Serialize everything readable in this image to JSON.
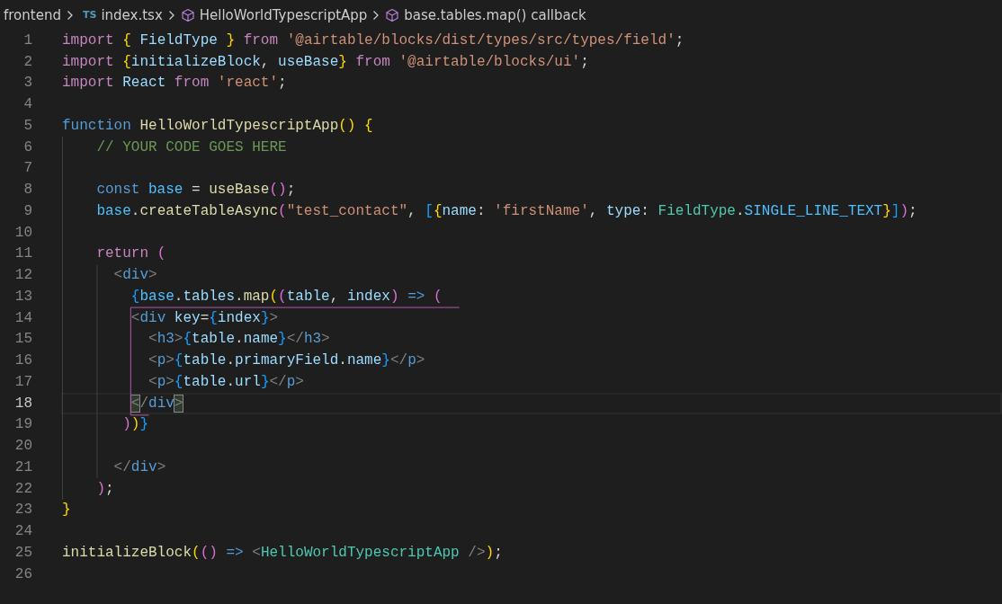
{
  "breadcrumb": [
    {
      "kind": "folder",
      "label": "frontend"
    },
    {
      "kind": "file",
      "badge": "TS",
      "label": "index.tsx"
    },
    {
      "kind": "symbol",
      "label": "HelloWorldTypescriptApp"
    },
    {
      "kind": "symbol",
      "label": "base.tables.map() callback"
    }
  ],
  "editor": {
    "lines": [
      {
        "number": "1",
        "current": false,
        "tokens": [
          {
            "kind": "keyword",
            "text": "import "
          },
          {
            "kind": "bracket1",
            "text": "{"
          },
          {
            "kind": "variable",
            "text": " FieldType "
          },
          {
            "kind": "bracket1",
            "text": "} "
          },
          {
            "kind": "keyword",
            "text": "from "
          },
          {
            "kind": "string",
            "text": "'@airtable/blocks/dist/types/src/types/field'"
          },
          {
            "kind": "plain",
            "text": ";"
          }
        ]
      },
      {
        "number": "2",
        "current": false,
        "tokens": [
          {
            "kind": "keyword",
            "text": "import "
          },
          {
            "kind": "bracket1",
            "text": "{"
          },
          {
            "kind": "variable",
            "text": "initializeBlock"
          },
          {
            "kind": "plain",
            "text": ", "
          },
          {
            "kind": "variable",
            "text": "useBase"
          },
          {
            "kind": "bracket1",
            "text": "} "
          },
          {
            "kind": "keyword",
            "text": "from "
          },
          {
            "kind": "string",
            "text": "'@airtable/blocks/ui'"
          },
          {
            "kind": "plain",
            "text": ";"
          }
        ]
      },
      {
        "number": "3",
        "current": false,
        "tokens": [
          {
            "kind": "keyword",
            "text": "import "
          },
          {
            "kind": "variable",
            "text": "React "
          },
          {
            "kind": "keyword",
            "text": "from "
          },
          {
            "kind": "string",
            "text": "'react'"
          },
          {
            "kind": "plain",
            "text": ";"
          }
        ]
      },
      {
        "number": "4",
        "current": false
      },
      {
        "number": "5",
        "current": false,
        "tokens": [
          {
            "kind": "storage",
            "text": "function "
          },
          {
            "kind": "function",
            "text": "HelloWorldTypescriptApp"
          },
          {
            "kind": "bracket1",
            "text": "() "
          },
          {
            "kind": "bracket1",
            "text": "{"
          }
        ]
      },
      {
        "number": "6",
        "current": false,
        "tokens": [
          {
            "kind": "comment",
            "text": "    // YOUR CODE GOES HERE"
          }
        ]
      },
      {
        "number": "7",
        "current": false
      },
      {
        "number": "8",
        "current": false,
        "tokens": [
          {
            "kind": "storage",
            "text": "    const "
          },
          {
            "kind": "constant",
            "text": "base"
          },
          {
            "kind": "plain",
            "text": " = "
          },
          {
            "kind": "function",
            "text": "useBase"
          },
          {
            "kind": "bracket2",
            "text": "()"
          },
          {
            "kind": "plain",
            "text": ";"
          }
        ]
      },
      {
        "number": "9",
        "current": false,
        "tokens": [
          {
            "kind": "constant",
            "text": "    base"
          },
          {
            "kind": "plain",
            "text": "."
          },
          {
            "kind": "function",
            "text": "createTableAsync"
          },
          {
            "kind": "bracket2",
            "text": "("
          },
          {
            "kind": "string",
            "text": "\"test_contact\""
          },
          {
            "kind": "plain",
            "text": ", "
          },
          {
            "kind": "bracket3",
            "text": "["
          },
          {
            "kind": "bracket1",
            "text": "{"
          },
          {
            "kind": "variable",
            "text": "name"
          },
          {
            "kind": "plain",
            "text": ": "
          },
          {
            "kind": "string",
            "text": "'firstName'"
          },
          {
            "kind": "plain",
            "text": ", "
          },
          {
            "kind": "variable",
            "text": "type"
          },
          {
            "kind": "plain",
            "text": ": "
          },
          {
            "kind": "type",
            "text": "FieldType"
          },
          {
            "kind": "plain",
            "text": "."
          },
          {
            "kind": "constant",
            "text": "SINGLE_LINE_TEXT"
          },
          {
            "kind": "bracket1",
            "text": "}"
          },
          {
            "kind": "bracket3",
            "text": "]"
          },
          {
            "kind": "bracket2",
            "text": ")"
          },
          {
            "kind": "plain",
            "text": ";"
          }
        ]
      },
      {
        "number": "10",
        "current": false
      },
      {
        "number": "11",
        "current": false,
        "tokens": [
          {
            "kind": "keyword",
            "text": "    return "
          },
          {
            "kind": "bracket2",
            "text": "("
          }
        ]
      },
      {
        "number": "12",
        "current": false,
        "tokens": [
          {
            "kind": "angle",
            "text": "      <"
          },
          {
            "kind": "tag",
            "text": "div"
          },
          {
            "kind": "angle",
            "text": ">"
          }
        ]
      },
      {
        "number": "13",
        "current": false,
        "tokens": [
          {
            "kind": "bracket3",
            "text": "        {"
          },
          {
            "kind": "constant",
            "text": "base"
          },
          {
            "kind": "plain",
            "text": "."
          },
          {
            "kind": "variable",
            "text": "tables"
          },
          {
            "kind": "plain",
            "text": "."
          },
          {
            "kind": "function",
            "text": "map"
          },
          {
            "kind": "bracket1",
            "text": "("
          },
          {
            "kind": "bracket2",
            "text": "("
          },
          {
            "kind": "variable",
            "text": "table"
          },
          {
            "kind": "plain",
            "text": ", "
          },
          {
            "kind": "variable",
            "text": "index"
          },
          {
            "kind": "bracket2",
            "text": ") "
          },
          {
            "kind": "storage",
            "text": "=> "
          },
          {
            "kind": "bracket2",
            "text": "("
          }
        ]
      },
      {
        "number": "14",
        "current": false,
        "tokens": [
          {
            "kind": "angle",
            "text": "        <"
          },
          {
            "kind": "tag",
            "text": "div "
          },
          {
            "kind": "variable",
            "text": "key"
          },
          {
            "kind": "plain",
            "text": "="
          },
          {
            "kind": "bracket3",
            "text": "{"
          },
          {
            "kind": "variable",
            "text": "index"
          },
          {
            "kind": "bracket3",
            "text": "}"
          },
          {
            "kind": "angle",
            "text": ">"
          }
        ]
      },
      {
        "number": "15",
        "current": false,
        "tokens": [
          {
            "kind": "angle",
            "text": "          <"
          },
          {
            "kind": "tag",
            "text": "h3"
          },
          {
            "kind": "angle",
            "text": ">"
          },
          {
            "kind": "bracket3",
            "text": "{"
          },
          {
            "kind": "variable",
            "text": "table"
          },
          {
            "kind": "plain",
            "text": "."
          },
          {
            "kind": "variable",
            "text": "name"
          },
          {
            "kind": "bracket3",
            "text": "}"
          },
          {
            "kind": "angle",
            "text": "</"
          },
          {
            "kind": "tag",
            "text": "h3"
          },
          {
            "kind": "angle",
            "text": ">"
          }
        ]
      },
      {
        "number": "16",
        "current": false,
        "tokens": [
          {
            "kind": "angle",
            "text": "          <"
          },
          {
            "kind": "tag",
            "text": "p"
          },
          {
            "kind": "angle",
            "text": ">"
          },
          {
            "kind": "bracket3",
            "text": "{"
          },
          {
            "kind": "variable",
            "text": "table"
          },
          {
            "kind": "plain",
            "text": "."
          },
          {
            "kind": "variable",
            "text": "primaryField"
          },
          {
            "kind": "plain",
            "text": "."
          },
          {
            "kind": "variable",
            "text": "name"
          },
          {
            "kind": "bracket3",
            "text": "}"
          },
          {
            "kind": "angle",
            "text": "</"
          },
          {
            "kind": "tag",
            "text": "p"
          },
          {
            "kind": "angle",
            "text": ">"
          }
        ]
      },
      {
        "number": "17",
        "current": false,
        "tokens": [
          {
            "kind": "angle",
            "text": "          <"
          },
          {
            "kind": "tag",
            "text": "p"
          },
          {
            "kind": "angle",
            "text": ">"
          },
          {
            "kind": "bracket3",
            "text": "{"
          },
          {
            "kind": "variable",
            "text": "table"
          },
          {
            "kind": "plain",
            "text": "."
          },
          {
            "kind": "variable",
            "text": "url"
          },
          {
            "kind": "bracket3",
            "text": "}"
          },
          {
            "kind": "angle",
            "text": "</"
          },
          {
            "kind": "tag",
            "text": "p"
          },
          {
            "kind": "angle",
            "text": ">"
          }
        ]
      },
      {
        "number": "18",
        "current": true,
        "tokens": [
          {
            "kind": "angle-match",
            "text": "        <"
          },
          {
            "kind": "angle",
            "text": "/"
          },
          {
            "kind": "tag",
            "text": "div"
          },
          {
            "kind": "angle-match",
            "text": ">"
          }
        ]
      },
      {
        "number": "19",
        "current": false,
        "tokens": [
          {
            "kind": "bracket2",
            "text": "       )"
          },
          {
            "kind": "bracket1",
            "text": ")"
          },
          {
            "kind": "bracket3",
            "text": "}"
          }
        ]
      },
      {
        "number": "20",
        "current": false
      },
      {
        "number": "21",
        "current": false,
        "tokens": [
          {
            "kind": "angle",
            "text": "      </"
          },
          {
            "kind": "tag",
            "text": "div"
          },
          {
            "kind": "angle",
            "text": ">"
          }
        ]
      },
      {
        "number": "22",
        "current": false,
        "tokens": [
          {
            "kind": "bracket2",
            "text": "    )"
          },
          {
            "kind": "plain",
            "text": ";"
          }
        ]
      },
      {
        "number": "23",
        "current": false,
        "tokens": [
          {
            "kind": "bracket1",
            "text": "}"
          }
        ]
      },
      {
        "number": "24",
        "current": false
      },
      {
        "number": "25",
        "current": false,
        "tokens": [
          {
            "kind": "function",
            "text": "initializeBlock"
          },
          {
            "kind": "bracket1",
            "text": "("
          },
          {
            "kind": "bracket2",
            "text": "() "
          },
          {
            "kind": "storage",
            "text": "=> "
          },
          {
            "kind": "angle",
            "text": "<"
          },
          {
            "kind": "type",
            "text": "HelloWorldTypescriptApp "
          },
          {
            "kind": "angle",
            "text": "/>"
          },
          {
            "kind": "bracket1",
            "text": ")"
          },
          {
            "kind": "plain",
            "text": ";"
          }
        ]
      },
      {
        "number": "26",
        "current": false
      }
    ]
  }
}
